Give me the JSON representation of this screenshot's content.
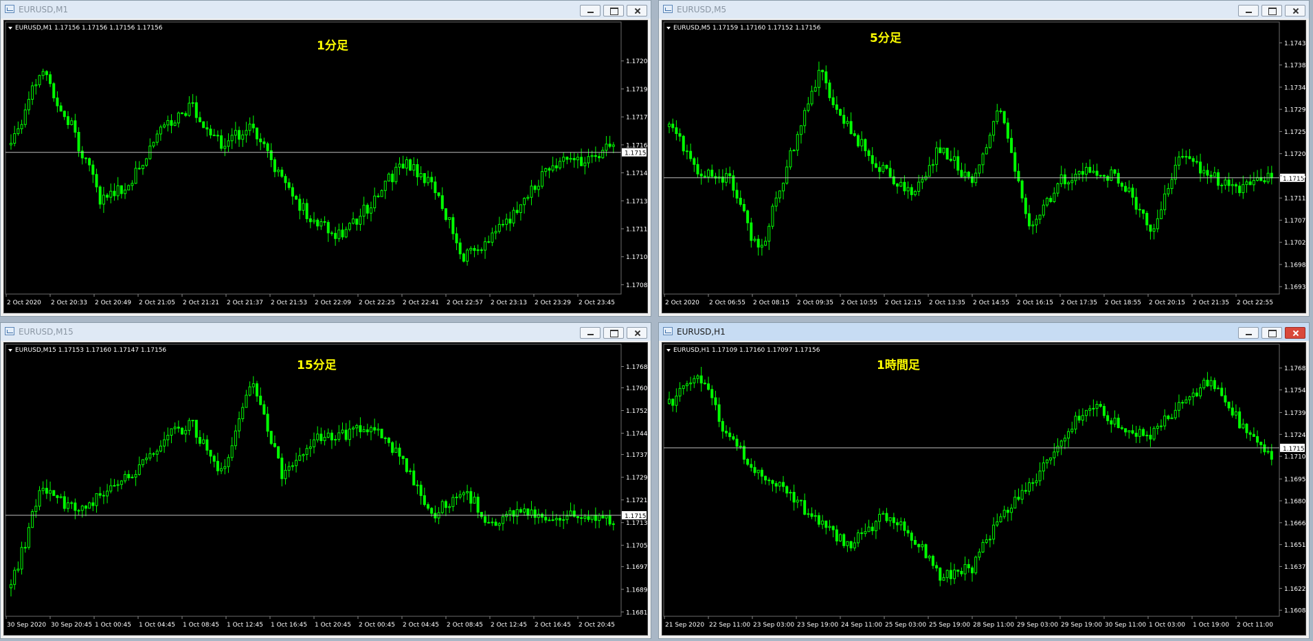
{
  "colors": {
    "chart_bg": "#000000",
    "candle": "#00ff00",
    "axis_text": "#ffffff",
    "annotation": "#ffff00",
    "price_line": "#c0c0c0"
  },
  "windows": [
    {
      "title": "EURUSD,M1",
      "info": "EURUSD,M1  1.17156 1.17156 1.17156 1.17156",
      "annotation": "1分足",
      "active": false,
      "current_price_label": "1.17156",
      "chart_data": {
        "type": "candlestick",
        "y_ticks": [
          "1.17205",
          "1.17190",
          "1.17175",
          "1.17160",
          "1.17145",
          "1.17130",
          "1.17115",
          "1.17100",
          "1.17085"
        ],
        "x_ticks": [
          "2 Oct 2020",
          "2 Oct 20:33",
          "2 Oct 20:49",
          "2 Oct 21:05",
          "2 Oct 21:21",
          "2 Oct 21:37",
          "2 Oct 21:53",
          "2 Oct 22:09",
          "2 Oct 22:25",
          "2 Oct 22:41",
          "2 Oct 22:57",
          "2 Oct 23:13",
          "2 Oct 23:29",
          "2 Oct 23:45"
        ],
        "ylim": [
          1.1708,
          1.1722
        ],
        "current_price": 1.17156,
        "trend": [
          1.1716,
          1.172,
          1.1717,
          1.1713,
          1.1714,
          1.1717,
          1.1718,
          1.1716,
          1.1717,
          1.1714,
          1.1712,
          1.1711,
          1.1713,
          1.1715,
          1.1714,
          1.171,
          1.1711,
          1.1713,
          1.1715,
          1.1715,
          1.1716
        ]
      }
    },
    {
      "title": "EURUSD,M5",
      "info": "EURUSD,M5  1.17159 1.17160 1.17152 1.17156",
      "annotation": "5分足",
      "active": false,
      "current_price_label": "1.17156",
      "chart_data": {
        "type": "candlestick",
        "y_ticks": [
          "1.17430",
          "1.17385",
          "1.17340",
          "1.17295",
          "1.17250",
          "1.17205",
          "1.17160",
          "1.17115",
          "1.17070",
          "1.17025",
          "1.16980",
          "1.16935"
        ],
        "x_ticks": [
          "2 Oct 2020",
          "2 Oct 06:55",
          "2 Oct 08:15",
          "2 Oct 09:35",
          "2 Oct 10:55",
          "2 Oct 12:15",
          "2 Oct 13:35",
          "2 Oct 14:55",
          "2 Oct 16:15",
          "2 Oct 17:35",
          "2 Oct 18:55",
          "2 Oct 20:15",
          "2 Oct 21:35",
          "2 Oct 22:55"
        ],
        "ylim": [
          1.1692,
          1.1745
        ],
        "current_price": 1.17156,
        "trend": [
          1.1726,
          1.1717,
          1.1715,
          1.17,
          1.172,
          1.1737,
          1.1725,
          1.1718,
          1.1712,
          1.1722,
          1.1715,
          1.173,
          1.1705,
          1.1715,
          1.1718,
          1.1715,
          1.1705,
          1.172,
          1.1716,
          1.1713,
          1.1716
        ]
      }
    },
    {
      "title": "EURUSD,M15",
      "info": "EURUSD,M15  1.17153 1.17160 1.17147 1.17156",
      "annotation": "15分足",
      "active": false,
      "current_price_label": "1.17156",
      "chart_data": {
        "type": "candlestick",
        "y_ticks": [
          "1.17680",
          "1.17605",
          "1.17525",
          "1.17445",
          "1.17370",
          "1.17290",
          "1.17210",
          "1.17130",
          "1.17050",
          "1.16975",
          "1.16895",
          "1.16815"
        ],
        "x_ticks": [
          "30 Sep 2020",
          "30 Sep 20:45",
          "1 Oct 00:45",
          "1 Oct 04:45",
          "1 Oct 08:45",
          "1 Oct 12:45",
          "1 Oct 16:45",
          "1 Oct 20:45",
          "2 Oct 00:45",
          "2 Oct 04:45",
          "2 Oct 08:45",
          "2 Oct 12:45",
          "2 Oct 16:45",
          "2 Oct 20:45"
        ],
        "ylim": [
          1.168,
          1.1772
        ],
        "current_price": 1.17156,
        "trend": [
          1.169,
          1.1725,
          1.1718,
          1.1722,
          1.173,
          1.1742,
          1.1748,
          1.173,
          1.1765,
          1.173,
          1.1742,
          1.1744,
          1.1746,
          1.1735,
          1.1715,
          1.1725,
          1.1712,
          1.1718,
          1.1714,
          1.1716,
          1.1714
        ]
      }
    },
    {
      "title": "EURUSD,H1",
      "info": "EURUSD,H1  1.17109 1.17160 1.17097 1.17156",
      "annotation": "1時間足",
      "active": true,
      "current_price_label": "1.17156",
      "chart_data": {
        "type": "candlestick",
        "y_ticks": [
          "1.17685",
          "1.17540",
          "1.17390",
          "1.17245",
          "1.17100",
          "1.16950",
          "1.16805",
          "1.16660",
          "1.16515",
          "1.16370",
          "1.16225",
          "1.16080"
        ],
        "x_ticks": [
          "21 Sep 2020",
          "22 Sep 11:00",
          "23 Sep 03:00",
          "23 Sep 19:00",
          "24 Sep 11:00",
          "25 Sep 03:00",
          "25 Sep 19:00",
          "28 Sep 11:00",
          "29 Sep 03:00",
          "29 Sep 19:00",
          "30 Sep 11:00",
          "1 Oct 03:00",
          "1 Oct 19:00",
          "2 Oct 11:00"
        ],
        "ylim": [
          1.1604,
          1.1777
        ],
        "current_price": 1.17156,
        "trend": [
          1.1745,
          1.1765,
          1.172,
          1.17,
          1.1685,
          1.1665,
          1.165,
          1.167,
          1.166,
          1.163,
          1.1635,
          1.167,
          1.169,
          1.172,
          1.1745,
          1.173,
          1.1725,
          1.1745,
          1.176,
          1.173,
          1.1712
        ]
      }
    }
  ]
}
